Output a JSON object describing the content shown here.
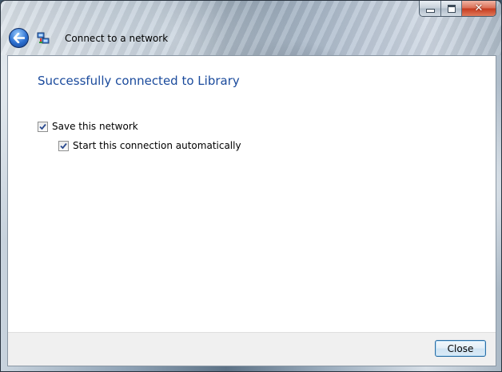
{
  "window": {
    "title": "Connect to a network",
    "controls": {
      "minimize_icon": "minimize-icon",
      "maximize_icon": "maximize-icon",
      "close_icon": "close-icon"
    }
  },
  "nav": {
    "back_icon": "back-arrow-icon",
    "app_icon": "network-icon"
  },
  "content": {
    "heading": "Successfully connected to Library",
    "options": [
      {
        "label": "Save this network",
        "checked": true
      },
      {
        "label": "Start this connection automatically",
        "checked": true
      }
    ]
  },
  "footer": {
    "close_label": "Close"
  },
  "colors": {
    "heading": "#1a4a9c",
    "button_border": "#2b6ea5"
  }
}
